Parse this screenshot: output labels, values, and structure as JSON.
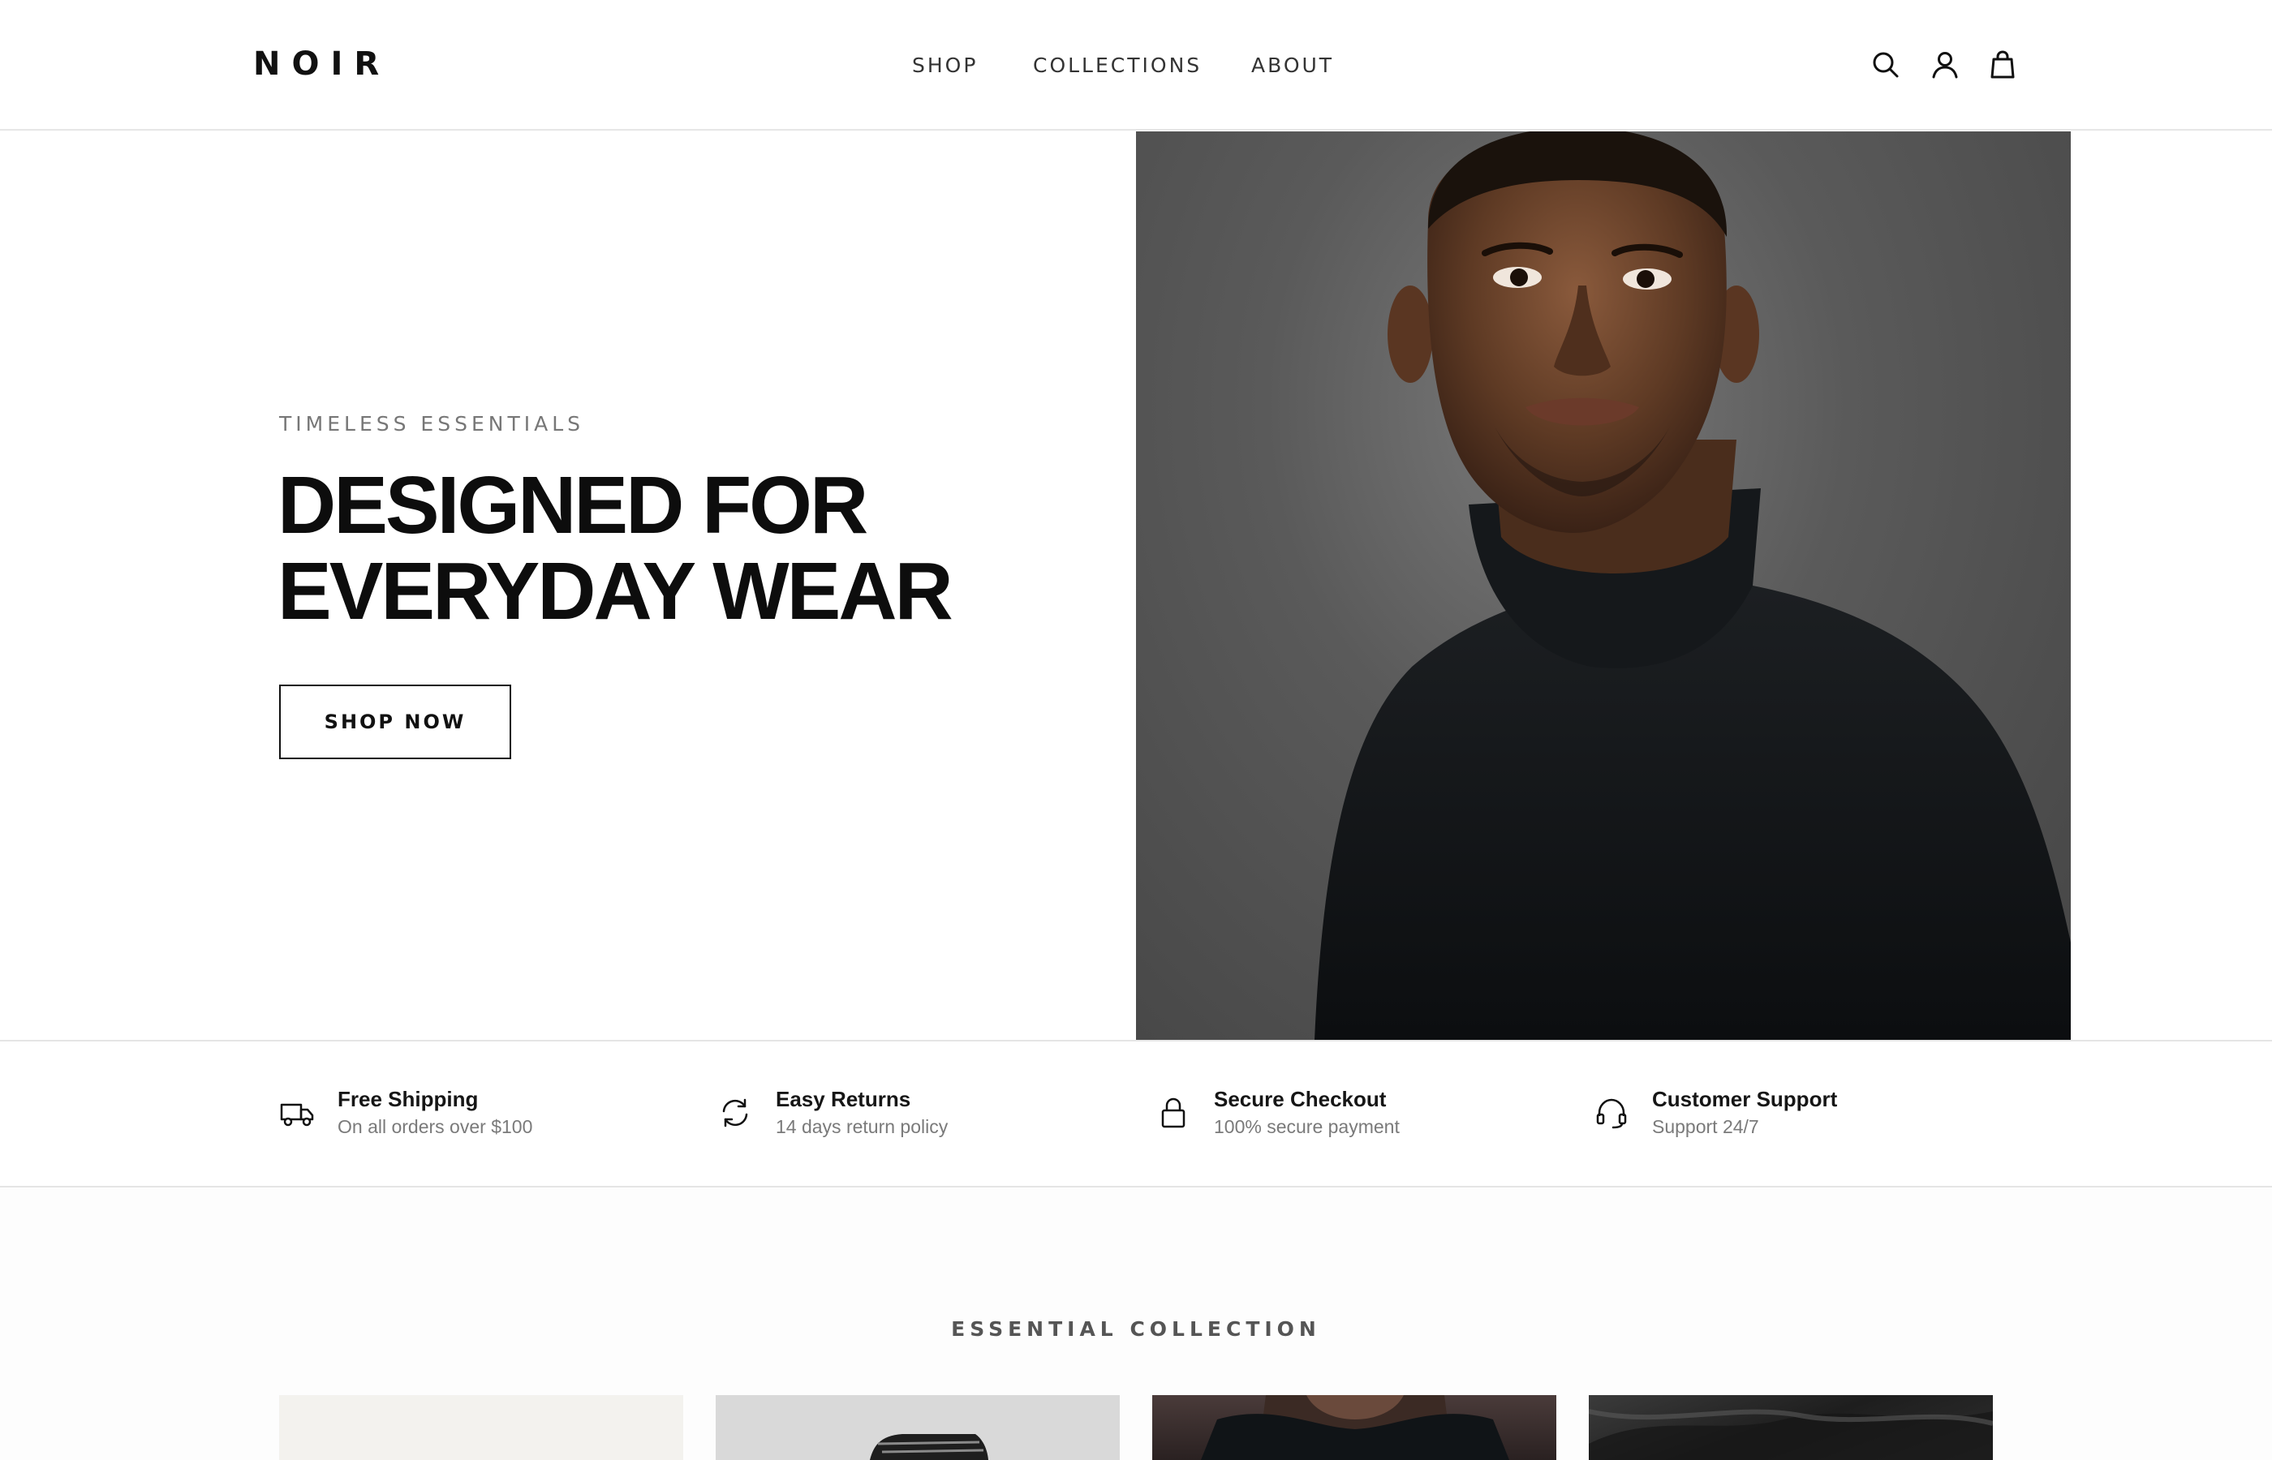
{
  "brand": {
    "logo": "NOIR"
  },
  "nav": {
    "items": [
      "SHOP",
      "COLLECTIONS",
      "ABOUT"
    ]
  },
  "header_icons": [
    "search-icon",
    "user-icon",
    "shopping-bag-icon"
  ],
  "hero": {
    "eyebrow": "TIMELESS ESSENTIALS",
    "headline_line1": "DESIGNED FOR",
    "headline_line2": "EVERYDAY WEAR",
    "cta": "SHOP NOW"
  },
  "features": [
    {
      "icon": "truck-icon",
      "title": "Free Shipping",
      "subtitle": "On all orders over $100"
    },
    {
      "icon": "refresh-icon",
      "title": "Easy Returns",
      "subtitle": "14 days return policy"
    },
    {
      "icon": "lock-icon",
      "title": "Secure Checkout",
      "subtitle": "100% secure payment"
    },
    {
      "icon": "headset-icon",
      "title": "Customer Support",
      "subtitle": "Support 24/7"
    }
  ],
  "collection": {
    "title": "ESSENTIAL COLLECTION"
  },
  "colors": {
    "text": "#111111",
    "muted": "#777777",
    "border": "#e5e5e5",
    "background": "#ffffff"
  }
}
